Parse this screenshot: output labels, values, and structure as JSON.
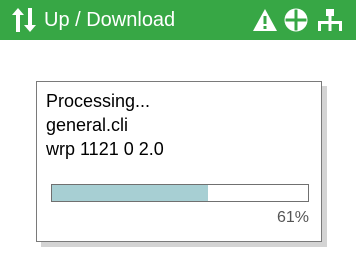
{
  "header": {
    "title": "Up / Download",
    "background_color": "#37a745",
    "title_icon": "up-down-arrows-icon",
    "status_icons": [
      "warning-triangle-icon",
      "circle-quadrant-icon",
      "network-icon"
    ]
  },
  "dialog": {
    "lines": [
      "Processing...",
      "general.cli",
      "wrp 1121 0 2.0"
    ],
    "progress": {
      "value": 0.61,
      "label": "61%",
      "fill_color": "#a7cfd3"
    }
  }
}
